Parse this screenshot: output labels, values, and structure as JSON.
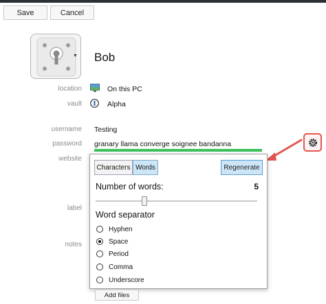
{
  "toolbar": {
    "save_label": "Save",
    "cancel_label": "Cancel"
  },
  "entry": {
    "title": "Bob",
    "location_label": "location",
    "location_value": "On this PC",
    "vault_label": "vault",
    "vault_value": "Alpha",
    "username_label": "username",
    "username_value": "Testing",
    "password_label": "password",
    "password_value": "granary llama converge soignee bandanna",
    "website_label": "website",
    "label_label": "label",
    "notes_label": "notes",
    "add_files_label": "Add files"
  },
  "generator": {
    "tab_characters": "Characters",
    "tab_words": "Words",
    "active_tab": "Words",
    "regenerate_label": "Regenerate",
    "num_words_label": "Number of words:",
    "num_words_value": "5",
    "slider_fraction": 0.3,
    "separator_label": "Word separator",
    "separators": [
      {
        "label": "Hyphen",
        "checked": false
      },
      {
        "label": "Space",
        "checked": true
      },
      {
        "label": "Period",
        "checked": false
      },
      {
        "label": "Comma",
        "checked": false
      },
      {
        "label": "Underscore",
        "checked": false
      }
    ]
  },
  "icons": {
    "vault_image": "keyhole-icon",
    "location": "pc-icon",
    "vault": "vault-circle-icon",
    "generator": "gear-icon",
    "annotation": "red-arrow-icon"
  },
  "colors": {
    "strength_bar": "#3ec05d",
    "annotation": "#e2554f",
    "selected_tab": "#cde6f7"
  }
}
